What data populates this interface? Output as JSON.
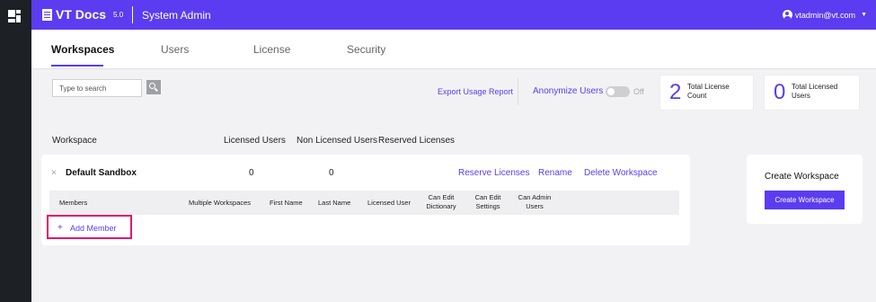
{
  "header": {
    "brand": "VT Docs",
    "version": "5.0",
    "title": "System Admin",
    "user": "vtadmin@vt.com"
  },
  "tabs": [
    {
      "label": "Workspaces",
      "active": true
    },
    {
      "label": "Users",
      "active": false
    },
    {
      "label": "License",
      "active": false
    },
    {
      "label": "Security",
      "active": false
    }
  ],
  "toolbar": {
    "search_placeholder": "Type to search",
    "export_label": "Export Usage Report",
    "anonymize_label": "Anonymize Users",
    "anonymize_state": "Off"
  },
  "stats": [
    {
      "value": "2",
      "label_line1": "Total License",
      "label_line2": "Count"
    },
    {
      "value": "0",
      "label_line1": "Total Licensed",
      "label_line2": "Users"
    }
  ],
  "table": {
    "columns": [
      "Workspace",
      "Licensed Users",
      "Non Licensed Users",
      "Reserved Licenses"
    ]
  },
  "workspace": {
    "name": "Default Sandbox",
    "licensed_users": "0",
    "non_licensed_users": "0",
    "actions": [
      "Reserve Licenses",
      "Rename",
      "Delete Workspace"
    ],
    "member_columns": [
      [
        "Members"
      ],
      [
        "Multiple Workspaces"
      ],
      [
        "First Name"
      ],
      [
        "Last Name"
      ],
      [
        "Licensed User"
      ],
      [
        "Can Edit",
        "Dictionary"
      ],
      [
        "Can Edit",
        "Settings"
      ],
      [
        "Can Admin",
        "Users"
      ]
    ],
    "add_member_label": "Add Member"
  },
  "create_panel": {
    "title": "Create Workspace",
    "button_label": "Create Workspace"
  },
  "colors": {
    "accent": "#5b3cf0",
    "highlight_border": "#e0186c",
    "rail": "#1d2024"
  }
}
